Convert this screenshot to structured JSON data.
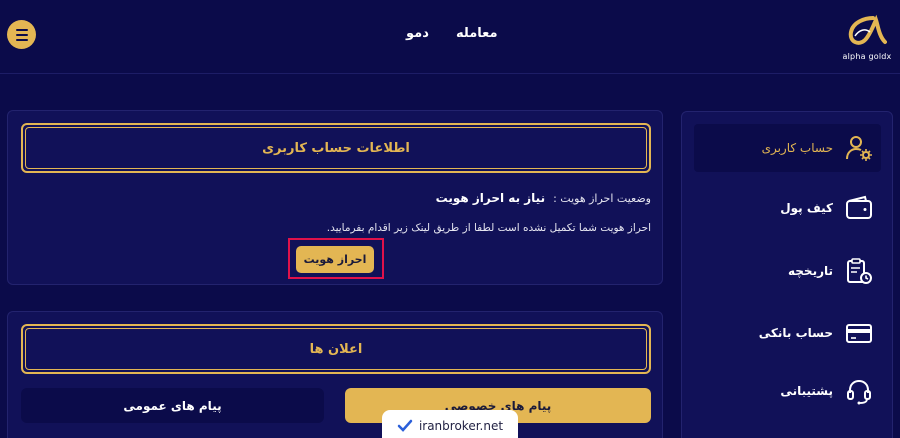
{
  "header": {
    "nav": {
      "trade": "معامله",
      "demo": "دمو"
    },
    "logo_text": "alpha goldx",
    "menu_icon": "hamburger-icon"
  },
  "account_panel": {
    "title": "اطلاعات حساب کاربری",
    "status_label": "وضعیت احراز هویت :",
    "status_value": "نیاز به احراز هویت",
    "info_text": "احراز هویت شما تکمیل نشده است لطفا از طریق لینک زیر اقدام بفرمایید.",
    "verify_button": "احراز هویت"
  },
  "notices_panel": {
    "title": "اعلان ها",
    "tabs": [
      {
        "label": "پیام های خصوصی",
        "active": true
      },
      {
        "label": "پیام های عمومی",
        "active": false
      }
    ]
  },
  "sidebar": {
    "items": [
      {
        "label": "حساب کاربری",
        "icon": "user-settings-icon",
        "active": true
      },
      {
        "label": "کیف پول",
        "icon": "wallet-icon",
        "active": false
      },
      {
        "label": "تاریخچه",
        "icon": "history-clipboard-icon",
        "active": false
      },
      {
        "label": "حساب بانکی",
        "icon": "credit-card-icon",
        "active": false
      },
      {
        "label": "پشتیبانی",
        "icon": "headset-icon",
        "active": false
      }
    ]
  },
  "watermark": {
    "text": "iranbroker.net"
  },
  "colors": {
    "background": "#0b0b4a",
    "panel": "#111158",
    "accent": "#e3b653",
    "highlight": "#e0124a"
  }
}
